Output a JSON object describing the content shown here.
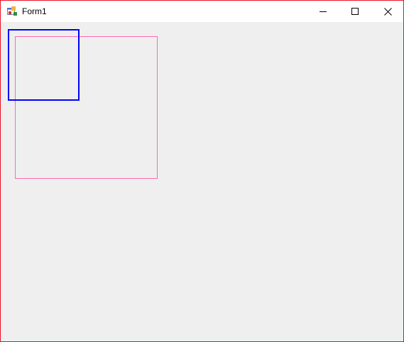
{
  "window": {
    "title": "Form1",
    "border_color": "#e81123",
    "background": "#efefef"
  },
  "titlebar": {
    "icon": "form-app-icon",
    "buttons": [
      {
        "name": "minimize",
        "icon": "minimize-icon"
      },
      {
        "name": "maximize",
        "icon": "maximize-icon"
      },
      {
        "name": "close",
        "icon": "close-icon"
      }
    ]
  },
  "canvas": {
    "shapes": [
      {
        "name": "blue-square",
        "color": "#0000ff"
      },
      {
        "name": "pink-square",
        "color": "#ff69b4"
      }
    ]
  }
}
